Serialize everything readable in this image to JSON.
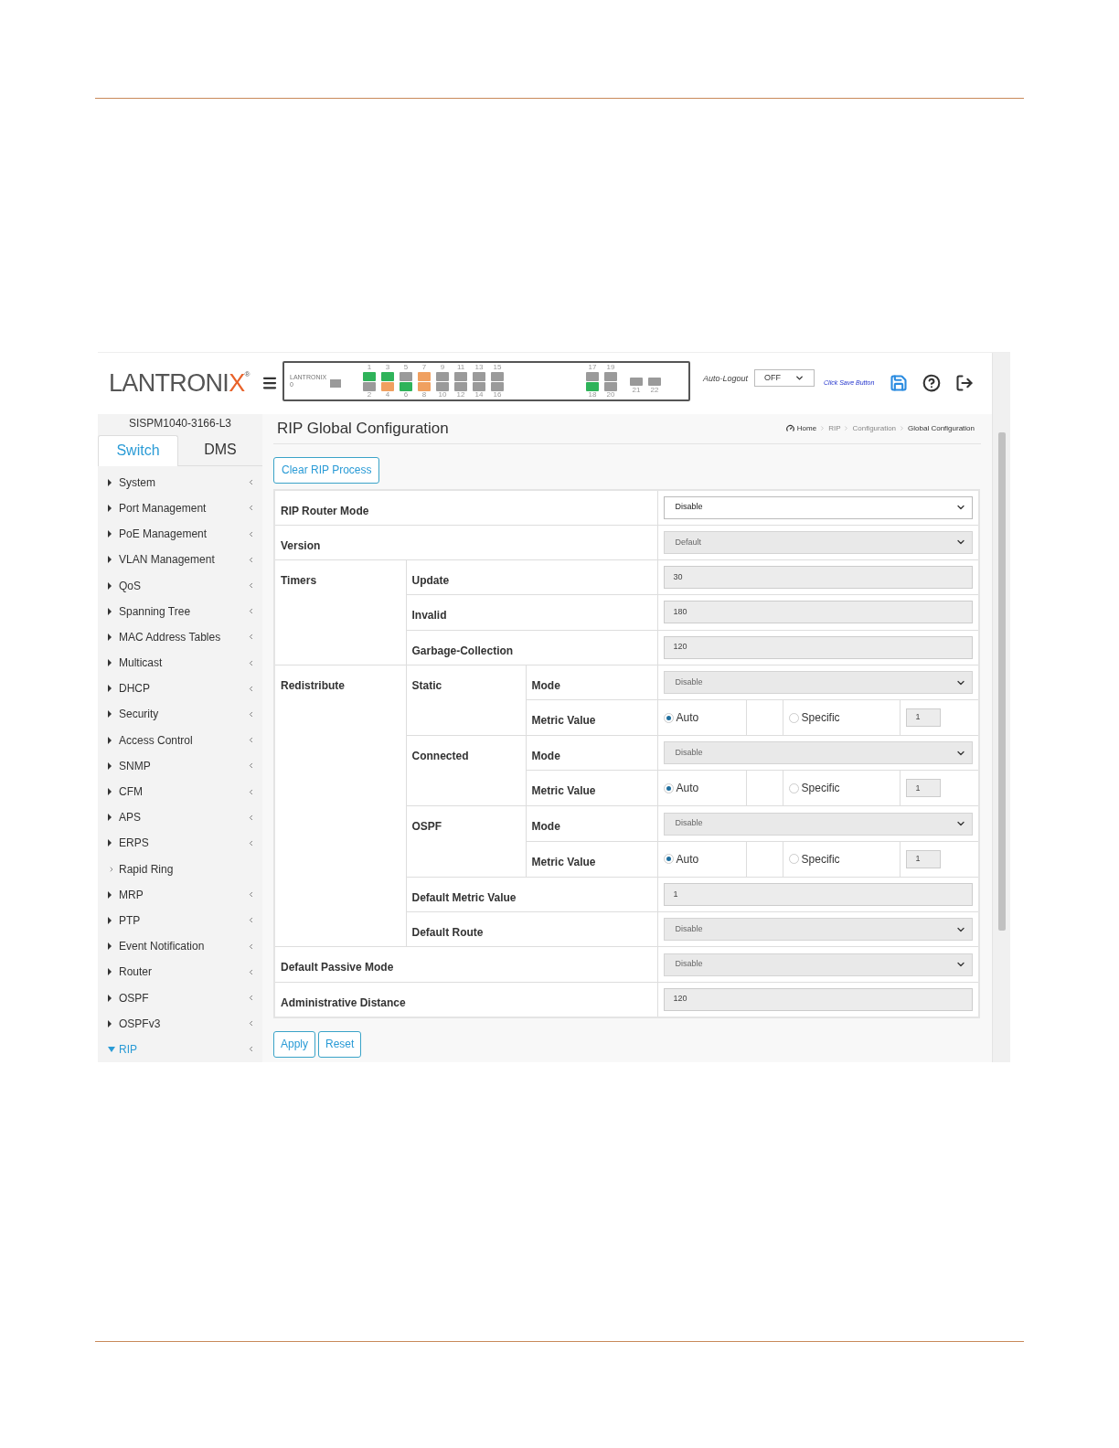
{
  "header": {
    "logo": {
      "main": "LANTRONI",
      "accent": "X",
      "mark": "®"
    },
    "panel": {
      "brand": "LANTRONIX",
      "console": "0",
      "ports": [
        {
          "top": {
            "label": "1",
            "color": "#2fb35a"
          },
          "bottom": {
            "label": "2",
            "color": "#9a9a9a"
          }
        },
        {
          "top": {
            "label": "3",
            "color": "#2fb35a"
          },
          "bottom": {
            "label": "4",
            "color": "#f0a060"
          }
        },
        {
          "top": {
            "label": "5",
            "color": "#9a9a9a"
          },
          "bottom": {
            "label": "6",
            "color": "#2fb35a"
          }
        },
        {
          "top": {
            "label": "7",
            "color": "#f0a060"
          },
          "bottom": {
            "label": "8",
            "color": "#f0a060"
          }
        },
        {
          "top": {
            "label": "9",
            "color": "#9a9a9a"
          },
          "bottom": {
            "label": "10",
            "color": "#9a9a9a"
          }
        },
        {
          "top": {
            "label": "11",
            "color": "#9a9a9a"
          },
          "bottom": {
            "label": "12",
            "color": "#9a9a9a"
          }
        },
        {
          "top": {
            "label": "13",
            "color": "#9a9a9a"
          },
          "bottom": {
            "label": "14",
            "color": "#9a9a9a"
          }
        },
        {
          "top": {
            "label": "15",
            "color": "#9a9a9a"
          },
          "bottom": {
            "label": "16",
            "color": "#9a9a9a"
          }
        }
      ],
      "sfp_ports": [
        {
          "top": {
            "label": "17",
            "color": "#9a9a9a"
          },
          "bottom": {
            "label": "18",
            "color": "#2fb35a"
          }
        },
        {
          "top": {
            "label": "19",
            "color": "#9a9a9a"
          },
          "bottom": {
            "label": "20",
            "color": "#9a9a9a"
          }
        }
      ],
      "extra_ports": [
        {
          "label": "21"
        },
        {
          "label": "22"
        }
      ]
    },
    "auto_logout": {
      "label": "Auto-Logout",
      "value": "OFF"
    },
    "save_hint": "Click Save Button"
  },
  "sidebar": {
    "model": "SISPM1040-3166-L3",
    "tabs": [
      {
        "label": "Switch",
        "selected": true
      },
      {
        "label": "DMS",
        "selected": false
      }
    ],
    "items": [
      {
        "label": "System",
        "expanded": false,
        "has_submenu": true
      },
      {
        "label": "Port Management",
        "expanded": false,
        "has_submenu": true
      },
      {
        "label": "PoE Management",
        "expanded": false,
        "has_submenu": true
      },
      {
        "label": "VLAN Management",
        "expanded": false,
        "has_submenu": true
      },
      {
        "label": "QoS",
        "expanded": false,
        "has_submenu": true
      },
      {
        "label": "Spanning Tree",
        "expanded": false,
        "has_submenu": true
      },
      {
        "label": "MAC Address Tables",
        "expanded": false,
        "has_submenu": true
      },
      {
        "label": "Multicast",
        "expanded": false,
        "has_submenu": true
      },
      {
        "label": "DHCP",
        "expanded": false,
        "has_submenu": true
      },
      {
        "label": "Security",
        "expanded": false,
        "has_submenu": true
      },
      {
        "label": "Access Control",
        "expanded": false,
        "has_submenu": true
      },
      {
        "label": "SNMP",
        "expanded": false,
        "has_submenu": true
      },
      {
        "label": "CFM",
        "expanded": false,
        "has_submenu": true
      },
      {
        "label": "APS",
        "expanded": false,
        "has_submenu": true
      },
      {
        "label": "ERPS",
        "expanded": false,
        "has_submenu": true
      },
      {
        "label": "Rapid Ring",
        "expanded": false,
        "has_submenu": false
      },
      {
        "label": "MRP",
        "expanded": false,
        "has_submenu": true
      },
      {
        "label": "PTP",
        "expanded": false,
        "has_submenu": true
      },
      {
        "label": "Event Notification",
        "expanded": false,
        "has_submenu": true
      },
      {
        "label": "Router",
        "expanded": false,
        "has_submenu": true
      },
      {
        "label": "OSPF",
        "expanded": false,
        "has_submenu": true
      },
      {
        "label": "OSPFv3",
        "expanded": false,
        "has_submenu": true
      },
      {
        "label": "RIP",
        "expanded": true,
        "has_submenu": true
      }
    ]
  },
  "main": {
    "title": "RIP Global Configuration",
    "breadcrumb": [
      "Home",
      "RIP",
      "Configuration",
      "Global Configuration"
    ],
    "top_button": "Clear RIP Process",
    "rows": [
      {
        "kind": "select",
        "label": "RIP Router Mode",
        "value": "Disable",
        "disabled": false
      },
      {
        "kind": "select",
        "label": "Version",
        "value": "Default",
        "disabled": true
      },
      {
        "kind": "group",
        "label": "Timers",
        "items": [
          {
            "kind": "text",
            "label": "Update",
            "value": "30",
            "disabled": true
          },
          {
            "kind": "text",
            "label": "Invalid",
            "value": "180",
            "disabled": true
          },
          {
            "kind": "text",
            "label": "Garbage-Collection",
            "value": "120",
            "disabled": true
          }
        ]
      },
      {
        "kind": "group",
        "label": "Redistribute",
        "items": [
          {
            "kind": "group",
            "label": "Static",
            "items": [
              {
                "kind": "select",
                "label": "Mode",
                "value": "Disable",
                "disabled": true
              },
              {
                "kind": "metric",
                "label": "Metric Value",
                "options": [
                  {
                    "label": "Auto",
                    "selected": true
                  },
                  {
                    "label": "Specific",
                    "selected": false
                  }
                ],
                "value": "1"
              }
            ]
          },
          {
            "kind": "group",
            "label": "Connected",
            "items": [
              {
                "kind": "select",
                "label": "Mode",
                "value": "Disable",
                "disabled": true
              },
              {
                "kind": "metric",
                "label": "Metric Value",
                "options": [
                  {
                    "label": "Auto",
                    "selected": true
                  },
                  {
                    "label": "Specific",
                    "selected": false
                  }
                ],
                "value": "1"
              }
            ]
          },
          {
            "kind": "group",
            "label": "OSPF",
            "items": [
              {
                "kind": "select",
                "label": "Mode",
                "value": "Disable",
                "disabled": true
              },
              {
                "kind": "metric",
                "label": "Metric Value",
                "options": [
                  {
                    "label": "Auto",
                    "selected": true
                  },
                  {
                    "label": "Specific",
                    "selected": false
                  }
                ],
                "value": "1"
              }
            ]
          },
          {
            "kind": "text",
            "label": "Default Metric Value",
            "value": "1",
            "disabled": true
          },
          {
            "kind": "select",
            "label": "Default Route",
            "value": "Disable",
            "disabled": true
          }
        ]
      },
      {
        "kind": "select",
        "label": "Default Passive Mode",
        "value": "Disable",
        "disabled": true
      },
      {
        "kind": "text",
        "label": "Administrative Distance",
        "value": "120",
        "disabled": true
      }
    ],
    "buttons": [
      "Apply",
      "Reset"
    ]
  }
}
